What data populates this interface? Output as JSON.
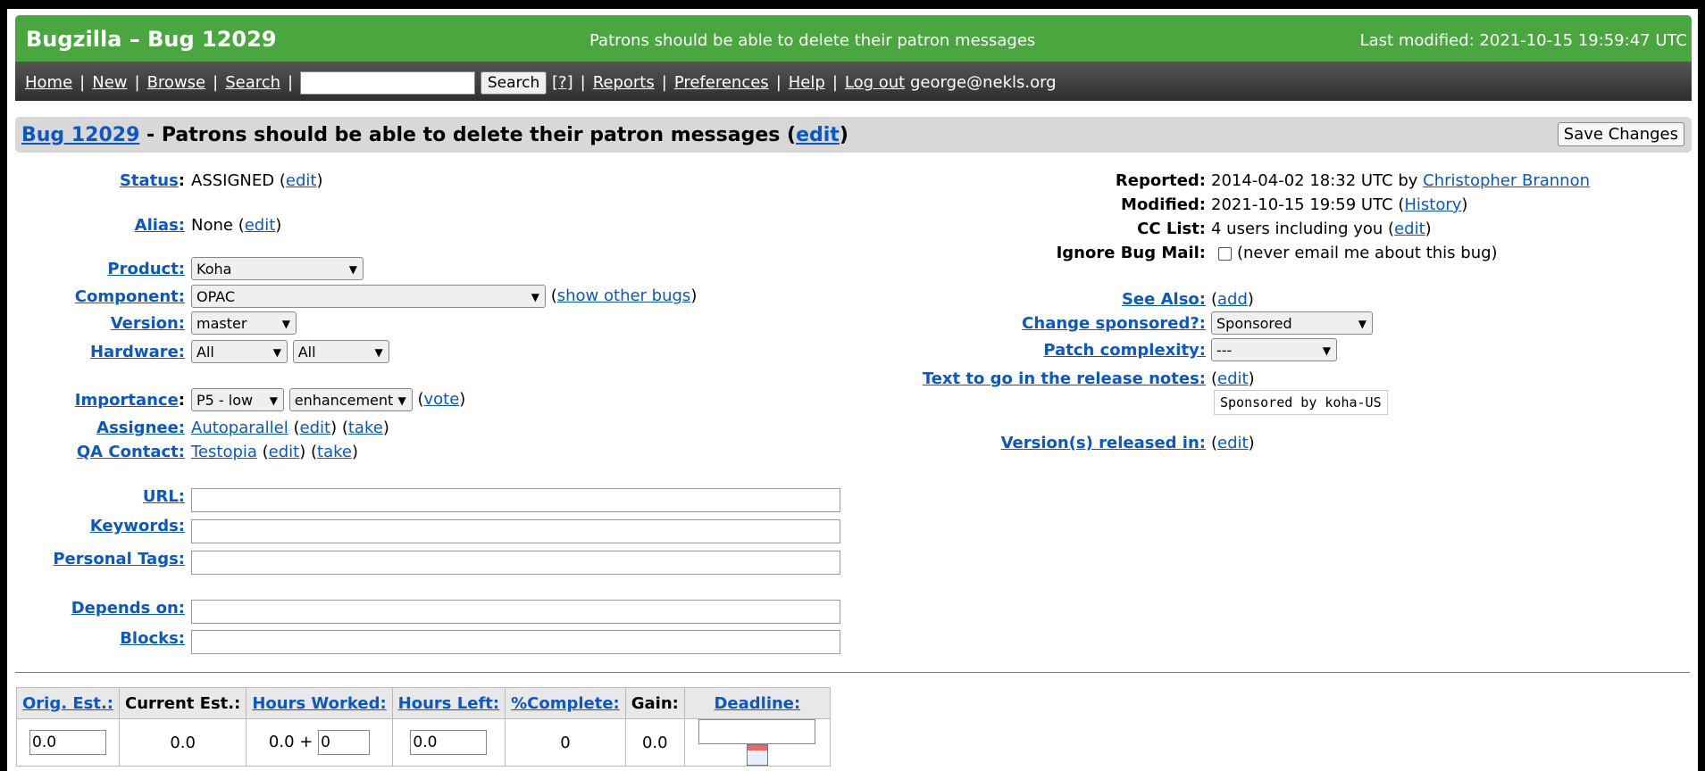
{
  "header": {
    "title": "Bugzilla – Bug 12029",
    "summary": "Patrons should be able to delete their patron messages",
    "last_modified": "Last modified: 2021-10-15 19:59:47 UTC"
  },
  "nav": {
    "home": "Home",
    "new": "New",
    "browse": "Browse",
    "search": "Search",
    "search_button": "Search",
    "help_q": "[?]",
    "reports": "Reports",
    "preferences": "Preferences",
    "help": "Help",
    "logout": "Log out",
    "user": "george@nekls.org",
    "sep": "|"
  },
  "bug": {
    "link": "Bug 12029",
    "title_text": " - Patrons should be able to delete their patron messages ",
    "edit": "edit",
    "save_button": "Save Changes"
  },
  "fields": {
    "status": {
      "label": "Status",
      "value": "ASSIGNED"
    },
    "alias": {
      "label": "Alias:",
      "value": "None"
    },
    "product": {
      "label": "Product:",
      "value": "Koha"
    },
    "component": {
      "label": "Component:",
      "value": "OPAC",
      "extra": "show other bugs"
    },
    "version": {
      "label": "Version:",
      "value": "master"
    },
    "hardware": {
      "label": "Hardware:",
      "value1": "All",
      "value2": "All"
    },
    "importance": {
      "label": "Importance",
      "priority": "P5 - low",
      "severity": "enhancement",
      "vote": "vote"
    },
    "assignee": {
      "label": "Assignee:",
      "value": "Autoparallel",
      "edit": "edit",
      "take": "take"
    },
    "qa_contact": {
      "label": "QA Contact:",
      "value": "Testopia",
      "edit": "edit",
      "take": "take"
    },
    "url": {
      "label": "URL:"
    },
    "keywords": {
      "label": "Keywords:"
    },
    "personal_tags": {
      "label": "Personal Tags:"
    },
    "depends_on": {
      "label": "Depends on:"
    },
    "blocks": {
      "label": "Blocks:"
    }
  },
  "right": {
    "reported": {
      "label": "Reported:",
      "value": "2014-04-02 18:32 UTC by ",
      "reporter": "Christopher Brannon"
    },
    "modified": {
      "label": "Modified:",
      "value": "2021-10-15 19:59 UTC (",
      "history": "History"
    },
    "cc": {
      "label": "CC List:",
      "value": "4 users including you (",
      "edit": "edit"
    },
    "ignore": {
      "label": "Ignore Bug Mail:",
      "value": "(never email me about this bug)"
    },
    "see_also": {
      "label": "See Also:",
      "add": "add"
    },
    "sponsored": {
      "label": "Change sponsored?:",
      "value": "Sponsored"
    },
    "patch": {
      "label": "Patch complexity:",
      "value": "---"
    },
    "release_notes": {
      "label": "Text to go in the release notes:",
      "edit": "edit",
      "value": "Sponsored by koha-US"
    },
    "versions_released": {
      "label": "Version(s) released in:",
      "edit": "edit"
    }
  },
  "time_table": {
    "headers": [
      "Orig. Est.:",
      "Current Est.:",
      "Hours Worked:",
      "Hours Left:",
      "%Complete:",
      "Gain:",
      "Deadline:"
    ],
    "orig_est": "0.0",
    "current_est": "0.0",
    "hours_worked": "0.0 +",
    "hours_worked_input": "0",
    "hours_left": "0.0",
    "percent_complete": "0",
    "gain": "0.0",
    "deadline": ""
  },
  "colors": {
    "header_green": "#4aa73f",
    "link_blue": "#0b58c4"
  }
}
